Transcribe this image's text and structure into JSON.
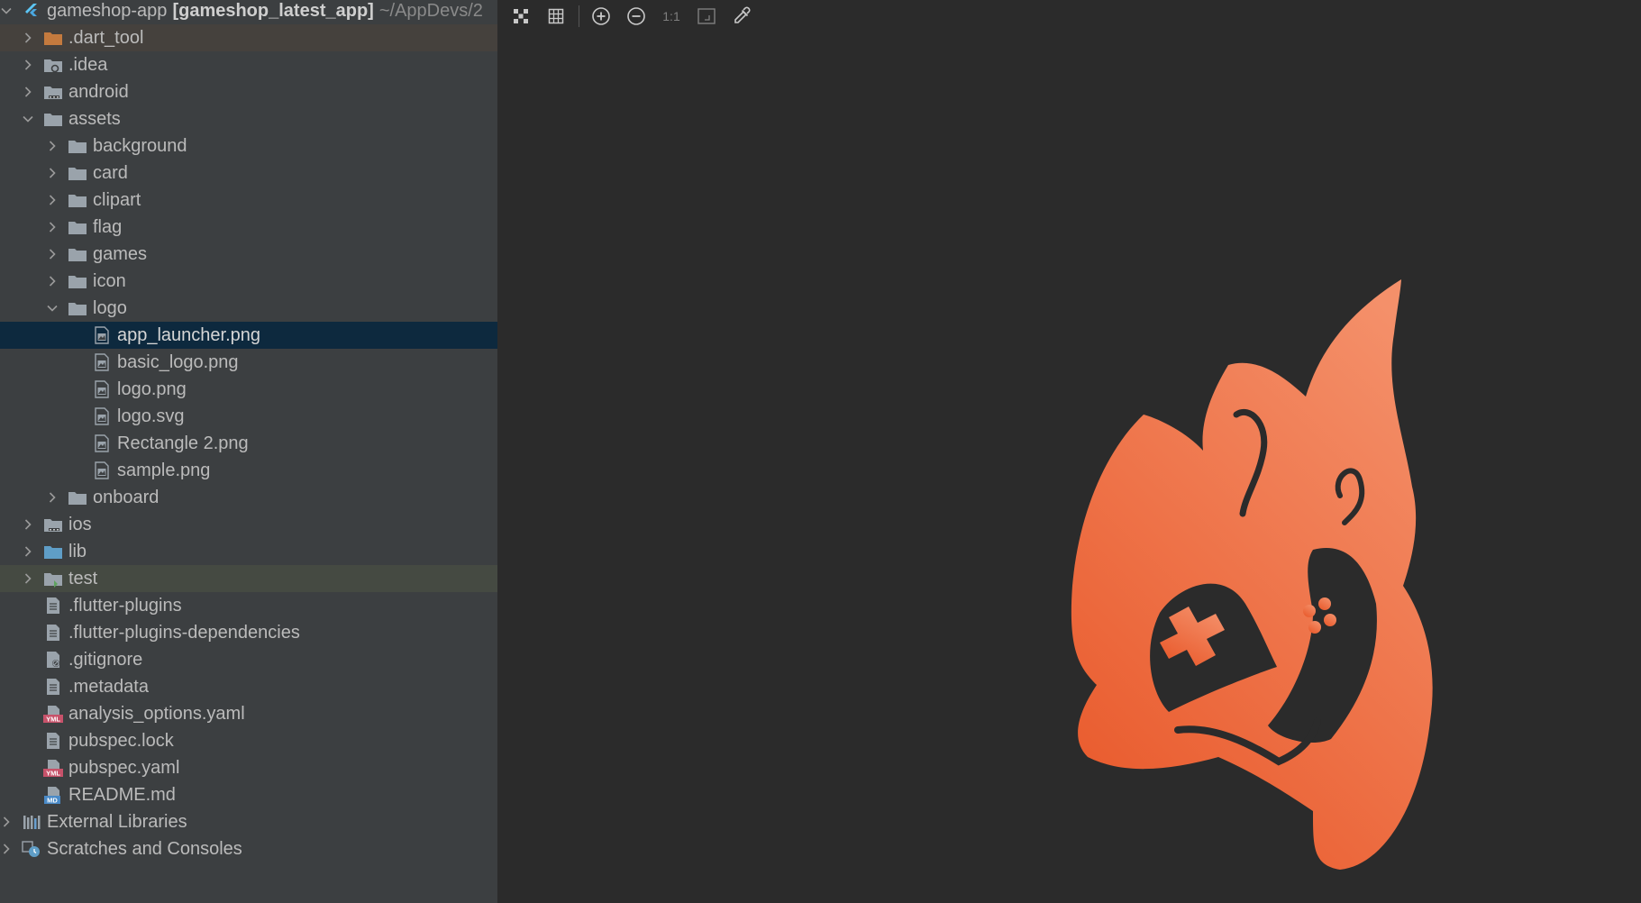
{
  "project": {
    "name": "gameshop-app",
    "module": "[gameshop_latest_app]",
    "path": "~/AppDevs/2"
  },
  "tree": [
    {
      "label": ".dart_tool",
      "depth": 1,
      "expand": "collapsed",
      "icon": "folder-orange-icon"
    },
    {
      "label": ".idea",
      "depth": 1,
      "expand": "collapsed",
      "icon": "folder-settings-icon"
    },
    {
      "label": "android",
      "depth": 1,
      "expand": "collapsed",
      "icon": "folder-module-icon"
    },
    {
      "label": "assets",
      "depth": 1,
      "expand": "expanded",
      "icon": "folder-icon"
    },
    {
      "label": "background",
      "depth": 2,
      "expand": "collapsed",
      "icon": "folder-icon"
    },
    {
      "label": "card",
      "depth": 2,
      "expand": "collapsed",
      "icon": "folder-icon"
    },
    {
      "label": "clipart",
      "depth": 2,
      "expand": "collapsed",
      "icon": "folder-icon"
    },
    {
      "label": "flag",
      "depth": 2,
      "expand": "collapsed",
      "icon": "folder-icon"
    },
    {
      "label": "games",
      "depth": 2,
      "expand": "collapsed",
      "icon": "folder-icon"
    },
    {
      "label": "icon",
      "depth": 2,
      "expand": "collapsed",
      "icon": "folder-icon"
    },
    {
      "label": "logo",
      "depth": 2,
      "expand": "expanded",
      "icon": "folder-icon"
    },
    {
      "label": "app_launcher.png",
      "depth": 3,
      "expand": "none",
      "icon": "image-file-icon",
      "selected": true
    },
    {
      "label": "basic_logo.png",
      "depth": 3,
      "expand": "none",
      "icon": "image-file-icon"
    },
    {
      "label": "logo.png",
      "depth": 3,
      "expand": "none",
      "icon": "image-file-icon"
    },
    {
      "label": "logo.svg",
      "depth": 3,
      "expand": "none",
      "icon": "image-file-icon"
    },
    {
      "label": "Rectangle 2.png",
      "depth": 3,
      "expand": "none",
      "icon": "image-file-icon"
    },
    {
      "label": "sample.png",
      "depth": 3,
      "expand": "none",
      "icon": "image-file-icon"
    },
    {
      "label": "onboard",
      "depth": 2,
      "expand": "collapsed",
      "icon": "folder-icon"
    },
    {
      "label": "ios",
      "depth": 1,
      "expand": "collapsed",
      "icon": "folder-module-icon"
    },
    {
      "label": "lib",
      "depth": 1,
      "expand": "collapsed",
      "icon": "folder-source-icon"
    },
    {
      "label": "test",
      "depth": 1,
      "expand": "collapsed",
      "icon": "folder-test-icon",
      "hover": true
    },
    {
      "label": ".flutter-plugins",
      "depth": 1,
      "expand": "none",
      "icon": "text-file-icon"
    },
    {
      "label": ".flutter-plugins-dependencies",
      "depth": 1,
      "expand": "none",
      "icon": "text-file-icon"
    },
    {
      "label": ".gitignore",
      "depth": 1,
      "expand": "none",
      "icon": "ignore-file-icon"
    },
    {
      "label": ".metadata",
      "depth": 1,
      "expand": "none",
      "icon": "text-file-icon"
    },
    {
      "label": "analysis_options.yaml",
      "depth": 1,
      "expand": "none",
      "icon": "yaml-file-icon"
    },
    {
      "label": "pubspec.lock",
      "depth": 1,
      "expand": "none",
      "icon": "text-file-icon"
    },
    {
      "label": "pubspec.yaml",
      "depth": 1,
      "expand": "none",
      "icon": "yaml-file-icon"
    },
    {
      "label": "README.md",
      "depth": 1,
      "expand": "none",
      "icon": "markdown-file-icon"
    },
    {
      "label": "External Libraries",
      "depth": 0,
      "expand": "collapsed",
      "icon": "libraries-icon"
    },
    {
      "label": "Scratches and Consoles",
      "depth": 0,
      "expand": "collapsed",
      "icon": "scratches-icon"
    }
  ],
  "toolbar": {
    "actual_size_label": "1:1"
  },
  "colors": {
    "selected_row": "#0d293e",
    "sidebar_bg": "#3c3f41",
    "viewer_bg": "#2b2b2b",
    "flame_top": "#f4906a",
    "flame_bottom": "#e95a2c"
  }
}
